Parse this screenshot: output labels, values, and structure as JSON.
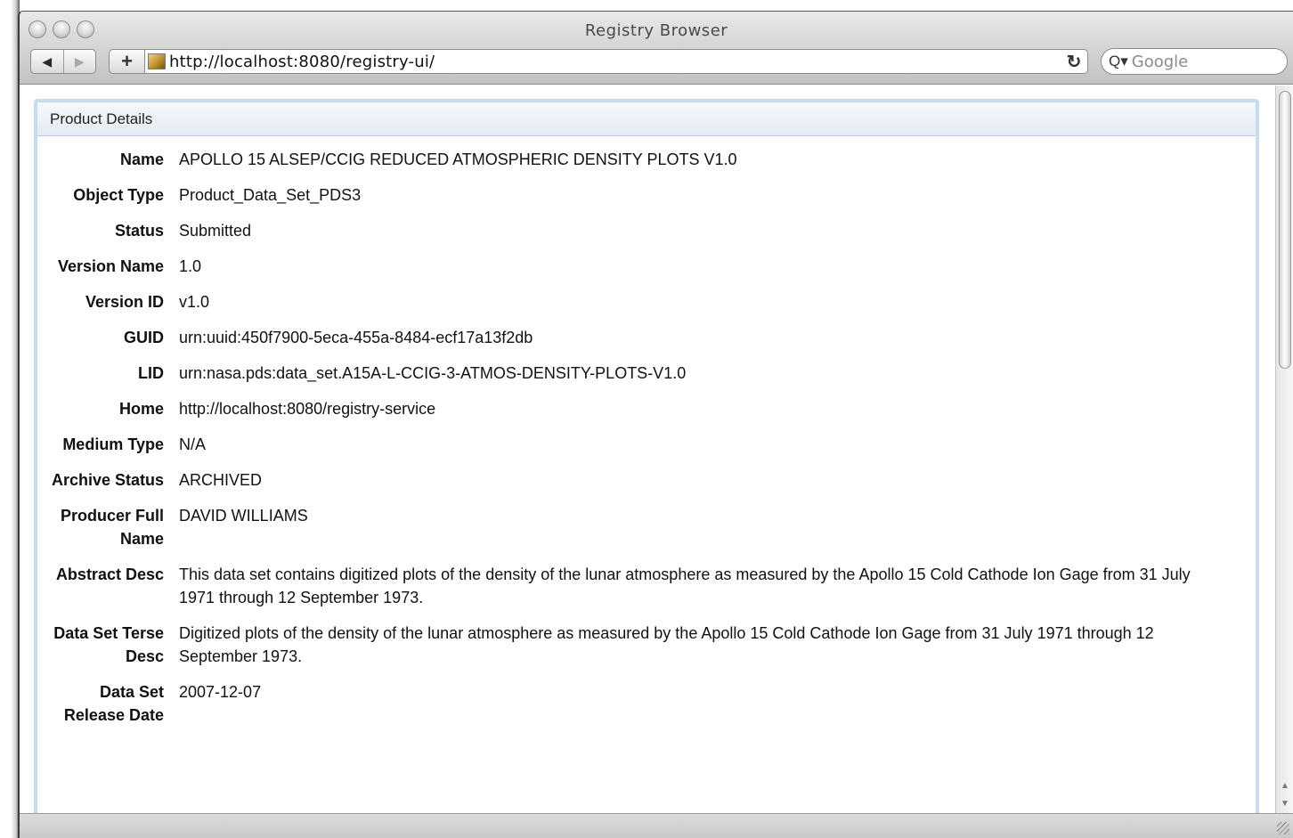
{
  "window": {
    "title": "Registry Browser"
  },
  "toolbar": {
    "back_icon": "◀",
    "forward_icon": "▶",
    "add_icon": "+",
    "url": "http://localhost:8080/registry-ui/",
    "reload_icon": "↻",
    "search_icon": "Q▾",
    "search_placeholder": "Google"
  },
  "panel": {
    "title": "Product Details",
    "fields": [
      {
        "label": "Name",
        "value": "APOLLO 15 ALSEP/CCIG REDUCED ATMOSPHERIC DENSITY PLOTS V1.0"
      },
      {
        "label": "Object Type",
        "value": "Product_Data_Set_PDS3"
      },
      {
        "label": "Status",
        "value": "Submitted"
      },
      {
        "label": "Version Name",
        "value": "1.0"
      },
      {
        "label": "Version ID",
        "value": "v1.0"
      },
      {
        "label": "GUID",
        "value": "urn:uuid:450f7900-5eca-455a-8484-ecf17a13f2db"
      },
      {
        "label": "LID",
        "value": "urn:nasa.pds:data_set.A15A-L-CCIG-3-ATMOS-DENSITY-PLOTS-V1.0"
      },
      {
        "label": "Home",
        "value": "http://localhost:8080/registry-service"
      },
      {
        "label": "Medium Type",
        "value": "N/A"
      },
      {
        "label": "Archive Status",
        "value": "ARCHIVED"
      },
      {
        "label": "Producer Full Name",
        "value": "DAVID WILLIAMS"
      },
      {
        "label": "Abstract Desc",
        "value": "This data set contains digitized plots of the density of the lunar atmosphere as measured by the Apollo 15 Cold Cathode Ion Gage from 31 July 1971 through 12 September 1973."
      },
      {
        "label": "Data Set Terse Desc",
        "value": "Digitized plots of the density of the lunar atmosphere as measured by the Apollo 15 Cold Cathode Ion Gage from 31 July 1971 through 12 September 1973."
      },
      {
        "label": "Data Set Release Date",
        "value": "2007-12-07"
      }
    ]
  }
}
